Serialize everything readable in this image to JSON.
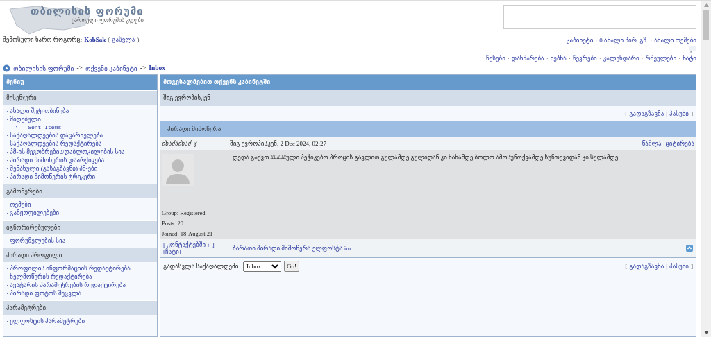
{
  "header": {
    "logo": {
      "title": "თბილისის ფორუმი",
      "subtitle": "ქართული ფორუმის კლუბი"
    },
    "login": {
      "prefix": "შემოსული ხართ როგორც:",
      "user": "KobSak",
      "open": "(",
      "logout": "გასვლა",
      "close": ")"
    },
    "separator": "·",
    "user_links": [
      "კაბინეტი",
      "0 ახალი პირ. გზ.",
      "ახალი თემები"
    ],
    "nav_links": [
      "წესები",
      "დახმარება",
      "ძებნა",
      "წევრები",
      "კალენდარი",
      "რჩეულები",
      "ჩატი"
    ]
  },
  "breadcrumb": [
    "თბილისის ფორუმი",
    "თქვენი კაბინეტი",
    "Inbox"
  ],
  "breadcrumb_separator": "->",
  "punctuation": {
    "open": "[",
    "divider": "|",
    "close": "]"
  },
  "sidebar": {
    "title": "მენიუ",
    "sections": [
      {
        "title": "მესენჯერი",
        "items": [
          {
            "label": "· ახალი შეტყობინება",
            "kind": "link"
          },
          {
            "label": "· მიღებული",
            "kind": "link"
          },
          {
            "label": "'-- Sent Items",
            "kind": "sub"
          },
          {
            "label": "· საქაღალდეების დაცარიელება",
            "kind": "link"
          },
          {
            "label": "· საქაღალდეების რედაქტირება",
            "kind": "link"
          },
          {
            "label": "· პმ-ის მეგობრების/დაბლოკილების სია",
            "kind": "link"
          },
          {
            "label": "· პირადი მიმოწერის დაარქივება",
            "kind": "link"
          },
          {
            "label": "· შენახული (გასაგზავნი) პმ-ები",
            "kind": "link"
          },
          {
            "label": "· პირადი მიმოწერის ტრეკერი",
            "kind": "link"
          }
        ]
      },
      {
        "title": "გამოწერები",
        "items": [
          {
            "label": "· თემები",
            "kind": "link"
          },
          {
            "label": "· განყოფილებები",
            "kind": "link"
          }
        ]
      },
      {
        "title": "იგნორირებულები",
        "items": [
          {
            "label": "· ფორუმელების სია",
            "kind": "link"
          }
        ]
      },
      {
        "title": "პირადი პროფილი",
        "items": [
          {
            "label": "· პროფილის ინფორმაციის რედაქტირება",
            "kind": "link"
          },
          {
            "label": "· ხელმოწერის რედაქტირება",
            "kind": "link"
          },
          {
            "label": "· ავატარის პარამეტრების რედაქტირება",
            "kind": "link"
          },
          {
            "label": "· პირადი ფოტოს შეცვლა",
            "kind": "link"
          }
        ]
      },
      {
        "title": "პარამეტრები",
        "items": [
          {
            "label": "· ელფოსტის პარამეტრები",
            "kind": "link"
          }
        ]
      }
    ]
  },
  "main": {
    "title": "მოგესალმებით თქვენს კაბინეტში",
    "subject": "შიგ ევროპისკენ",
    "actions": [
      "გადაგზავნა",
      "პასუხი"
    ],
    "section_title": "პირადი მიმოწერა",
    "message": {
      "author": "ძხაძაძხაძ_ჯ",
      "date": "შიგ ევროპისკენ, 2 Dec 2024, 02:27",
      "links": [
        "წაშლა",
        "ციტირება"
      ],
      "body": "დედა გაქვთ #####ული პეჭიკებო პროცის გავლით გულამდე გულიდან კი ხახამდე ბოლო ამოსუნთქვამდე სუნთქვიდან კი სულამდე",
      "signature": "--------------------",
      "group": "Group: Registered",
      "posts": "Posts: 20",
      "joined": "Joined: 18-August 21",
      "contact": "[ კონტაქტებში + ]",
      "chat": "[ჩატი]",
      "footer_note": "ბარათი პირადი მიმოწერა ელფოსტა im"
    },
    "folder_label": "გადასვლა საქაღალდეში:",
    "folder_value": "Inbox",
    "go": "Go!",
    "actions_bottom": [
      "გადაგზავნა",
      "პასუხი"
    ]
  }
}
